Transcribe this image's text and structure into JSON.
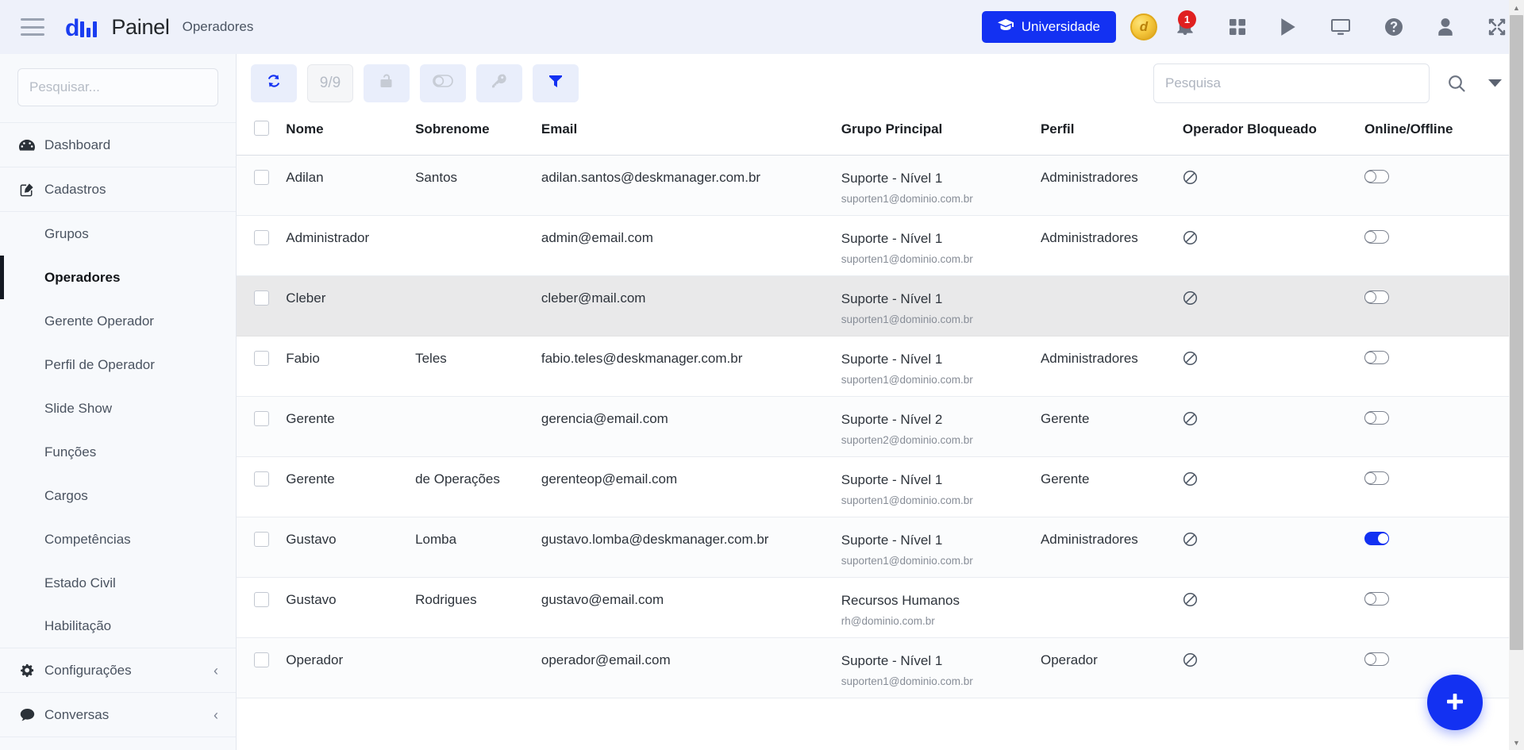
{
  "header": {
    "menu_icon": "hamburger-icon",
    "logo_text": "d",
    "app_title": "Painel",
    "breadcrumb": "Operadores",
    "universidade_label": "Universidade",
    "universidade_icon": "graduation-cap-icon",
    "coin_symbol": "d",
    "notification_count": "1",
    "icons": [
      "grid-apps-icon",
      "play-icon",
      "monitor-icon",
      "help-circle-icon",
      "user-icon",
      "expand-icon"
    ]
  },
  "sidebar": {
    "search_placeholder": "Pesquisar...",
    "nav": [
      {
        "label": "Dashboard",
        "icon": "dashboard-icon"
      },
      {
        "label": "Cadastros",
        "icon": "edit-square-icon"
      }
    ],
    "sub_items": [
      {
        "label": "Grupos",
        "active": false
      },
      {
        "label": "Operadores",
        "active": true
      },
      {
        "label": "Gerente Operador",
        "active": false
      },
      {
        "label": "Perfil de Operador",
        "active": false
      },
      {
        "label": "Slide Show",
        "active": false
      },
      {
        "label": "Funções",
        "active": false
      },
      {
        "label": "Cargos",
        "active": false
      },
      {
        "label": "Competências",
        "active": false
      },
      {
        "label": "Estado Civil",
        "active": false
      },
      {
        "label": "Habilitação",
        "active": false
      }
    ],
    "bottom_nav": [
      {
        "label": "Configurações",
        "icon": "gear-icon",
        "chevron": "‹"
      },
      {
        "label": "Conversas",
        "icon": "chat-bubble-icon",
        "chevron": "‹"
      }
    ]
  },
  "toolbar": {
    "refresh_label": "refresh-icon",
    "count_label": "9/9",
    "lock_label": "unlock-icon",
    "toggle_label": "toggle-icon",
    "key_label": "key-icon",
    "filter_label": "filter-icon",
    "search_placeholder": "Pesquisa",
    "search_value": "",
    "search_icon": "search-icon",
    "caret_icon": "chevron-down-icon"
  },
  "table": {
    "columns": [
      "Nome",
      "Sobrenome",
      "Email",
      "Grupo Principal",
      "Perfil",
      "Operador Bloqueado",
      "Online/Offline"
    ],
    "rows": [
      {
        "nome": "Adilan",
        "sobrenome": "Santos",
        "email": "adilan.santos@deskmanager.com.br",
        "grupo": "Suporte - Nível 1",
        "grupo_email": "suporten1@dominio.com.br",
        "perfil": "Administradores",
        "bloqueado": "⊘",
        "online": false
      },
      {
        "nome": "Administrador",
        "sobrenome": "",
        "email": "admin@email.com",
        "grupo": "Suporte - Nível 1",
        "grupo_email": "suporten1@dominio.com.br",
        "perfil": "Administradores",
        "bloqueado": "⊘",
        "online": false
      },
      {
        "nome": "Cleber",
        "sobrenome": "",
        "email": "cleber@mail.com",
        "grupo": "Suporte - Nível 1",
        "grupo_email": "suporten1@dominio.com.br",
        "perfil": "",
        "bloqueado": "⊘",
        "online": false
      },
      {
        "nome": "Fabio",
        "sobrenome": "Teles",
        "email": "fabio.teles@deskmanager.com.br",
        "grupo": "Suporte - Nível 1",
        "grupo_email": "suporten1@dominio.com.br",
        "perfil": "Administradores",
        "bloqueado": "⊘",
        "online": false
      },
      {
        "nome": "Gerente",
        "sobrenome": "",
        "email": "gerencia@email.com",
        "grupo": "Suporte - Nível 2",
        "grupo_email": "suporten2@dominio.com.br",
        "perfil": "Gerente",
        "bloqueado": "⊘",
        "online": false
      },
      {
        "nome": "Gerente",
        "sobrenome": "de Operações",
        "email": "gerenteop@email.com",
        "grupo": "Suporte - Nível 1",
        "grupo_email": "suporten1@dominio.com.br",
        "perfil": "Gerente",
        "bloqueado": "⊘",
        "online": false
      },
      {
        "nome": "Gustavo",
        "sobrenome": "Lomba",
        "email": "gustavo.lomba@deskmanager.com.br",
        "grupo": "Suporte - Nível 1",
        "grupo_email": "suporten1@dominio.com.br",
        "perfil": "Administradores",
        "bloqueado": "⊘",
        "online": true
      },
      {
        "nome": "Gustavo",
        "sobrenome": "Rodrigues",
        "email": "gustavo@email.com",
        "grupo": "Recursos Humanos",
        "grupo_email": "rh@dominio.com.br",
        "perfil": "",
        "bloqueado": "⊘",
        "online": false
      },
      {
        "nome": "Operador",
        "sobrenome": "",
        "email": "operador@email.com",
        "grupo": "Suporte - Nível 1",
        "grupo_email": "suporten1@dominio.com.br",
        "perfil": "Operador",
        "bloqueado": "⊘",
        "online": false
      }
    ],
    "selected_row_index": 2
  },
  "fab": {
    "icon": "plus-icon"
  },
  "colors": {
    "accent": "#1331f2",
    "header_bg": "#eef1fa",
    "sidebar_bg": "#f7f9fc",
    "badge": "#e02020",
    "coin": "#f6c93f"
  }
}
